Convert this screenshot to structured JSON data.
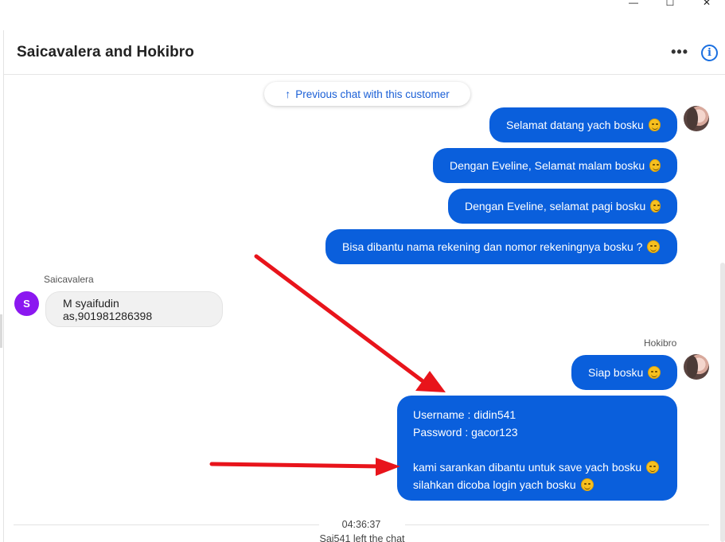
{
  "window_controls": {
    "minimize": "—",
    "maximize": "☐",
    "close": "✕"
  },
  "header": {
    "title": "Saicavalera and Hokibro",
    "more_label": "•••",
    "info_label": "i"
  },
  "previous_chat": {
    "arrow": "↑",
    "label": "Previous chat with this customer"
  },
  "messages_out_1": [
    "Selamat datang yach bosku",
    "Dengan Eveline, Selamat malam bosku",
    "Dengan Eveline, selamat pagi bosku",
    "Bisa dibantu nama rekening dan nomor rekeningnya bosku ?"
  ],
  "customer": {
    "name": "Saicavalera",
    "initial": "S",
    "message": "M syaifudin as,901981286398"
  },
  "agent": {
    "name": "Hokibro",
    "message_1": "Siap bosku",
    "credentials": {
      "line1": "Username : didin541",
      "line2": "Password : gacor123",
      "line3": "kami sarankan dibantu untuk save yach bosku",
      "line4": "silahkan dicoba login yach bosku"
    }
  },
  "footer": {
    "timestamp": "04:36:37",
    "system_message": "Sai541 left the chat"
  },
  "colors": {
    "bubble_out": "#0a5fdc",
    "bubble_in": "#f1f1f1",
    "accent": "#1a6fe0",
    "customer_avatar": "#8b18f0",
    "annotation_arrow": "#e8141b"
  }
}
